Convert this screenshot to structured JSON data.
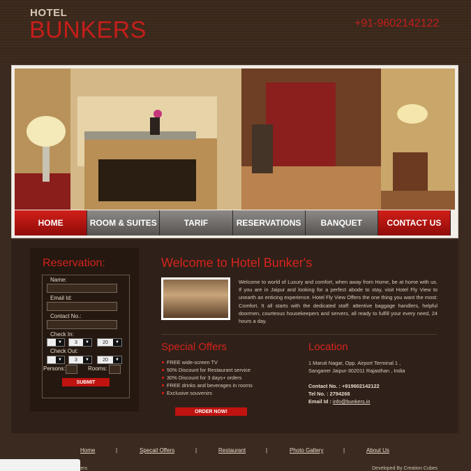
{
  "header": {
    "logo_top": "HOTEL",
    "logo_main": "BUNKERS",
    "phone": "+91-9602142122"
  },
  "nav": {
    "items": [
      {
        "label": "HOME"
      },
      {
        "label": "ROOM & SUITES"
      },
      {
        "label": "TARIF"
      },
      {
        "label": "RESERVATIONS"
      },
      {
        "label": "BANQUET"
      },
      {
        "label": "CONTACT US"
      }
    ]
  },
  "reservation": {
    "title": "Reservation:",
    "name_label": "Name:",
    "email_label": "Email Id:",
    "contact_label": "Contact No.:",
    "checkin_label": "Check In:",
    "checkin_month": "3",
    "checkin_day": "20",
    "checkout_label": "Check Out:",
    "checkout_month": "3",
    "checkout_day": "20",
    "persons_label": "Persons:",
    "rooms_label": "Rooms:",
    "submit_label": "SUBMIT"
  },
  "welcome": {
    "title": "Welcome to Hotel Bunker's",
    "text": "Welcome to world of Luxury and comfort, when away from Home, be at home with us. If you are in Jaipur and looking for a perfect abode to stay, visit Hotel Fly View to unearth an enticing experience. Hotel Fly View Offers the one thing you want the most: Comfort. It all starts with the dedicated staff: attentive baggage handlers, helpful doormen, courteous housekeepers and servers, all ready to fulfill your every need, 24 hours a day."
  },
  "offers": {
    "title": "Special Offers",
    "items": [
      "FREE wide-screen TV",
      "50% Discount for Restaurant service",
      "30% Discount for 3 days+ orders",
      "FREE drinks and beverages in rooms",
      "Exclusive souvenirs"
    ],
    "order_label": "ORDER NOW!"
  },
  "location": {
    "title": "Location",
    "address1": "1 Maruti Nagar, Opp. Airport Terminal 1 ,",
    "address2": "Sanganer Jaipur-302011 Rajasthan , India",
    "contact_label": "Contact No. :",
    "contact_value": "+919602142122",
    "tel_label": "Tel No. :",
    "tel_value": "2794268",
    "email_label": "Email Id :",
    "email_value": "info@bunkers.in"
  },
  "footer": {
    "links": [
      "Home",
      "Specail Offers",
      "Restaurant",
      "Photo Gallery",
      "About Us"
    ],
    "separator": "|",
    "left_text": "nkers",
    "right_text": "Developed By Creation Cubes"
  },
  "colors": {
    "accent_red": "#c41e1a",
    "background": "#3b2a20",
    "panel": "#2f2119"
  }
}
